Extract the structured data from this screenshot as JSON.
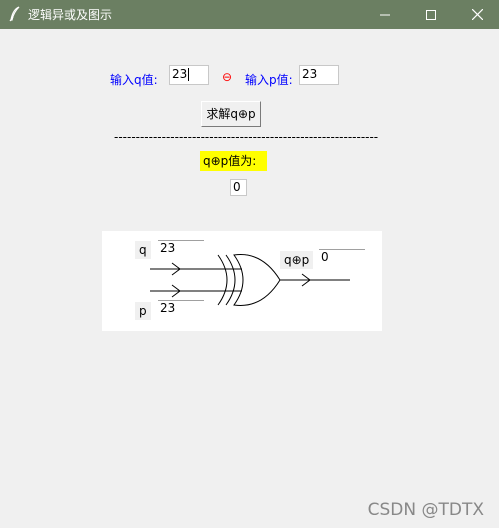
{
  "window": {
    "title": "逻辑异或及图示",
    "minimize_glyph": "—",
    "maximize_glyph": "☐",
    "close_glyph": "✕"
  },
  "inputs": {
    "q_label": "输入q值:",
    "q_value": "23",
    "xor_symbol": "⊖",
    "p_label": "输入p值:",
    "p_value": "23"
  },
  "solve_button": {
    "label": "求解q⊕p"
  },
  "separator": "-------------------------------------------------------------",
  "result": {
    "label": "q⊕p值为:",
    "value": "0"
  },
  "diagram": {
    "q_label": "q",
    "q_value": "23",
    "p_label": "p",
    "p_value": "23",
    "output_label": "q⊕p",
    "output_value": "0"
  },
  "watermark": "CSDN @TDTX",
  "colors": {
    "titlebar": "#6b7f62",
    "label_blue": "#0000ff",
    "xor_red": "#ff0000",
    "result_highlight": "#ffff00"
  }
}
